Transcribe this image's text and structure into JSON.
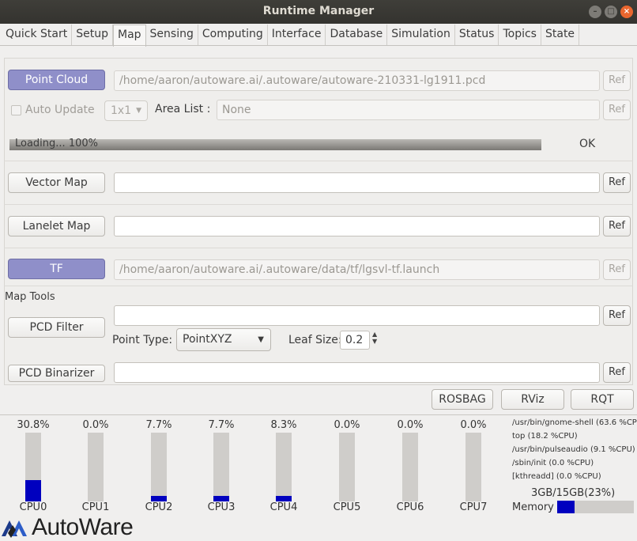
{
  "window": {
    "title": "Runtime Manager"
  },
  "tabs": [
    "Quick Start",
    "Setup",
    "Map",
    "Sensing",
    "Computing",
    "Interface",
    "Database",
    "Simulation",
    "Status",
    "Topics",
    "State"
  ],
  "active_tab": "Map",
  "point_cloud": {
    "button": "Point Cloud",
    "path": "/home/aaron/autoware.ai/.autoware/autoware-210331-lg1911.pcd",
    "ref": "Ref",
    "auto_update": "Auto Update",
    "grid": "1x1",
    "area_list_label": "Area List :",
    "area_list_value": "None",
    "area_ref": "Ref",
    "progress_text": "Loading...  100%",
    "progress": 100,
    "status": "OK"
  },
  "vector_map": {
    "button": "Vector Map",
    "path": "",
    "ref": "Ref"
  },
  "lanelet_map": {
    "button": "Lanelet Map",
    "path": "",
    "ref": "Ref"
  },
  "tf": {
    "button": "TF",
    "path": "/home/aaron/autoware.ai/.autoware/data/tf/lgsvl-tf.launch",
    "ref": "Ref"
  },
  "map_tools": {
    "label": "Map Tools",
    "pcd_filter": {
      "button": "PCD Filter",
      "path": "",
      "ref": "Ref"
    },
    "point_type_label": "Point Type:",
    "point_type": "PointXYZ",
    "leaf_size_label": "Leaf Size:",
    "leaf_size": "0.2",
    "pcd_binarizer": {
      "button": "PCD Binarizer",
      "path": "",
      "ref": "Ref"
    }
  },
  "bottom_buttons": [
    "ROSBAG",
    "RViz",
    "RQT"
  ],
  "cpus": [
    {
      "name": "CPU0",
      "pct_label": "30.8%",
      "pct": 30.8
    },
    {
      "name": "CPU1",
      "pct_label": "0.0%",
      "pct": 0.0
    },
    {
      "name": "CPU2",
      "pct_label": "7.7%",
      "pct": 7.7
    },
    {
      "name": "CPU3",
      "pct_label": "7.7%",
      "pct": 7.7
    },
    {
      "name": "CPU4",
      "pct_label": "8.3%",
      "pct": 8.3
    },
    {
      "name": "CPU5",
      "pct_label": "0.0%",
      "pct": 0.0
    },
    {
      "name": "CPU6",
      "pct_label": "0.0%",
      "pct": 0.0
    },
    {
      "name": "CPU7",
      "pct_label": "0.0%",
      "pct": 0.0
    }
  ],
  "processes": [
    "/usr/bin/gnome-shell (63.6 %CPU)",
    "top (18.2 %CPU)",
    "/usr/bin/pulseaudio (9.1 %CPU)",
    "/sbin/init (0.0 %CPU)",
    "[kthreadd] (0.0 %CPU)"
  ],
  "memory": {
    "label": "Memory",
    "text": "3GB/15GB(23%)",
    "pct": 23
  },
  "logo": {
    "text": "AutoWare"
  },
  "colors": {
    "active_button": "#8f8fc9",
    "usage_bar": "#0000bf",
    "titlebar": "#3a3935"
  }
}
